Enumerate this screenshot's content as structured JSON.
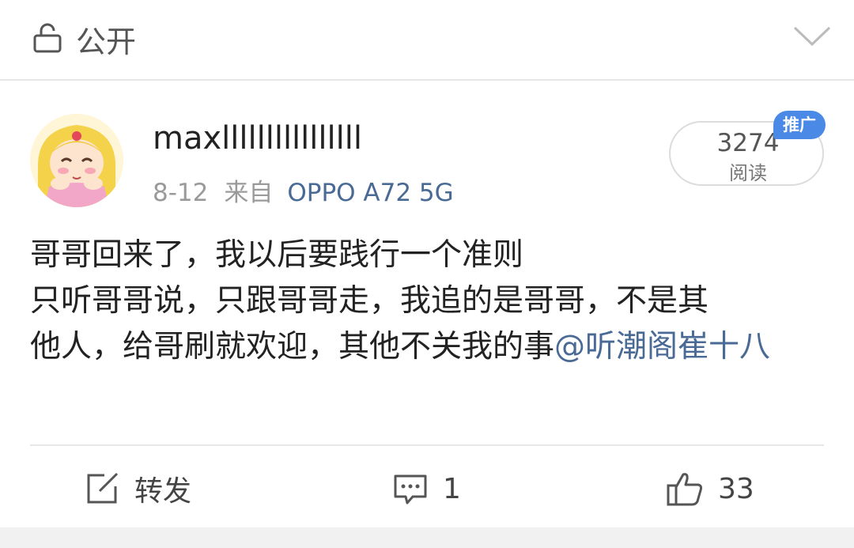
{
  "visibility": {
    "label": "公开",
    "icon": "lock-icon"
  },
  "post": {
    "author": "maxllllllllllllllll",
    "date": "8-12",
    "source_prefix": "来自",
    "device": "OPPO A72 5G",
    "reads": {
      "count": "3274",
      "label": "阅读"
    },
    "promo_badge": "推广",
    "text_lines": [
      "哥哥回来了，我以后要践行一个准则",
      "只听哥哥说，只跟哥哥走，我追的是哥哥，不是其",
      "他人，给哥刷就欢迎，其他不关我的事"
    ],
    "mention": "@听潮阁崔十八"
  },
  "actions": {
    "repost_label": "转发",
    "comment_count": "1",
    "like_count": "33"
  },
  "colors": {
    "link": "#4a6a96",
    "badge": "#4a8ae6"
  }
}
